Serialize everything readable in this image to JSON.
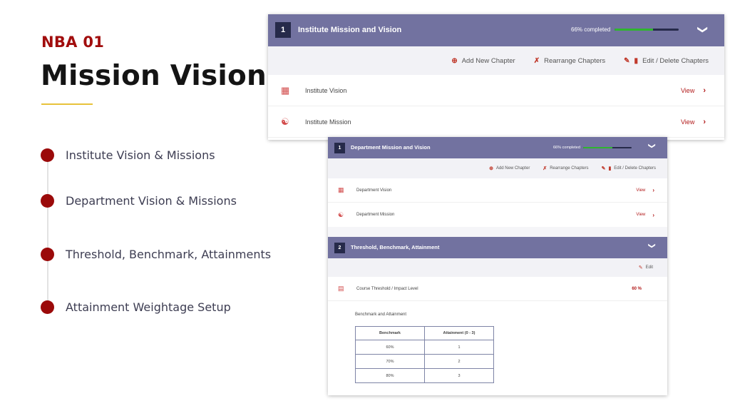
{
  "slide": {
    "kicker": "NBA 01",
    "title": "Mission Vision",
    "accent_color": "#a10d0d",
    "rule_color": "#e7c23a",
    "timeline": [
      {
        "label": "Institute Vision & Missions"
      },
      {
        "label": "Department Vision & Missions"
      },
      {
        "label": "Threshold, Benchmark, Attainments"
      },
      {
        "label": "Attainment Weightage Setup"
      }
    ]
  },
  "card1": {
    "number": "1",
    "title": "Institute Mission and Vision",
    "progress_text": "66% completed",
    "progress": 0.6,
    "toolbar": {
      "add": "Add New Chapter",
      "rearrange": "Rearrange Chapters",
      "edit": "Edit / Delete Chapters"
    },
    "rows": [
      {
        "label": "Institute Vision",
        "action": "View"
      },
      {
        "label": "Institute Mission",
        "action": "View"
      }
    ]
  },
  "card2": {
    "section1": {
      "number": "1",
      "title": "Department Mission and Vision",
      "progress_text": "66% completed",
      "progress": 0.6,
      "toolbar": {
        "add": "Add New Chapter",
        "rearrange": "Rearrange Chapters",
        "edit": "Edit / Delete Chapters"
      },
      "rows": [
        {
          "label": "Department Vision",
          "action": "View"
        },
        {
          "label": "Department Mission",
          "action": "View"
        }
      ]
    },
    "section2": {
      "number": "2",
      "title": "Threshold, Benchmark, Attainment",
      "edit_label": "Edit",
      "threshold_label": "Course Threshold / Impact Level",
      "threshold_value": "60 %",
      "benchmark_title": "Benchmark and Attainment",
      "table": {
        "headers": [
          "Benchmark",
          "Attainment (0 - 3)"
        ],
        "rows": [
          [
            "60%",
            "1"
          ],
          [
            "70%",
            "2"
          ],
          [
            "80%",
            "3"
          ]
        ]
      }
    }
  },
  "colors": {
    "header_bg": "#7272a0",
    "badge_bg": "#262a4a",
    "progress_fill": "#2fb52f",
    "link": "#b21a1a"
  },
  "icons": {
    "chevron": "chevron-down-icon",
    "arrow": "chevron-right-icon",
    "add": "add-circle-icon",
    "rearrange": "shuffle-icon",
    "edit": "pencil-icon",
    "delete": "trash-icon",
    "vision": "org-chart-icon",
    "mission": "people-network-icon",
    "document": "document-icon"
  }
}
